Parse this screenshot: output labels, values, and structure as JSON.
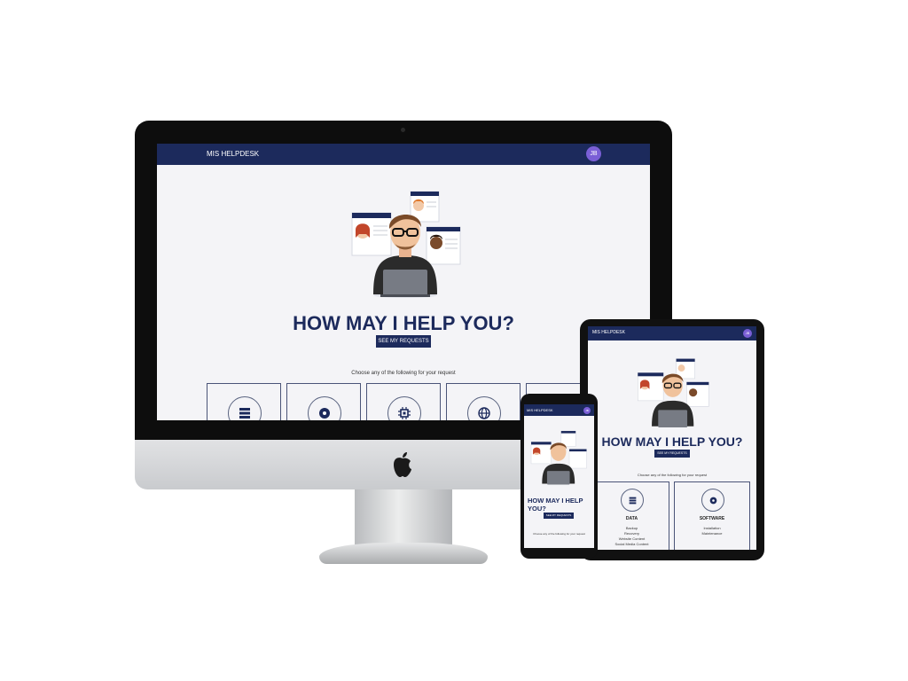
{
  "app": {
    "title": "MIS HELPDESK",
    "user_initials": "JB"
  },
  "hero": {
    "heading": "HOW MAY I HELP YOU?",
    "button_label": "SEE MY REQUESTS",
    "choose_text": "Choose any of the following for your request"
  },
  "categories": [
    {
      "icon": "server-icon",
      "title": "DATA",
      "items": [
        "Backup",
        "Recovery",
        "Website Content",
        "Social Media Content"
      ]
    },
    {
      "icon": "disc-icon",
      "title": "SOFTWARE",
      "items": [
        "Installation",
        "Maintenance"
      ]
    },
    {
      "icon": "chip-icon"
    },
    {
      "icon": "globe-icon"
    },
    {
      "icon": "partial-card"
    }
  ],
  "colors": {
    "navbar": "#1c2a5c",
    "accent": "#7a5fd6",
    "page_bg": "#f4f4f7",
    "heading": "#1c2a5c"
  }
}
